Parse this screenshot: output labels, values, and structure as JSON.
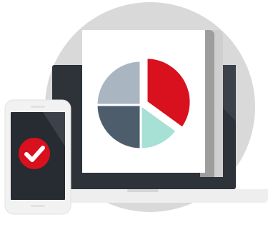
{
  "scene": {
    "description_name": "device-report-illustration"
  },
  "colors": {
    "background": "#ffffff",
    "halo": "#d9d9d9",
    "device_dark": "#2d3339",
    "device_dark_alt": "#262c31",
    "screen_highlight": "#3b4249",
    "paper": "#ffffff",
    "paper_fold": "#cfcfcf",
    "paper_fold_dark": "#9d9d9d",
    "laptop_base": "#eeeeee",
    "laptop_base_shadow": "#d6d6d6",
    "phone_body": "#f2f2f2",
    "phone_border": "#e2e2e2",
    "accent_red": "#d9101e",
    "check_white": "#ffffff"
  },
  "chart_data": {
    "type": "pie",
    "categories": [
      "",
      "",
      "",
      ""
    ],
    "values": [
      35,
      15,
      25,
      25
    ],
    "colors": [
      "#d9101e",
      "#a7e0d5",
      "#4e5d6c",
      "#a9b6c1"
    ],
    "exploded": [
      true,
      false,
      false,
      false
    ],
    "title": "",
    "legend": "none"
  },
  "icons": {
    "check": "check-circle-icon"
  }
}
